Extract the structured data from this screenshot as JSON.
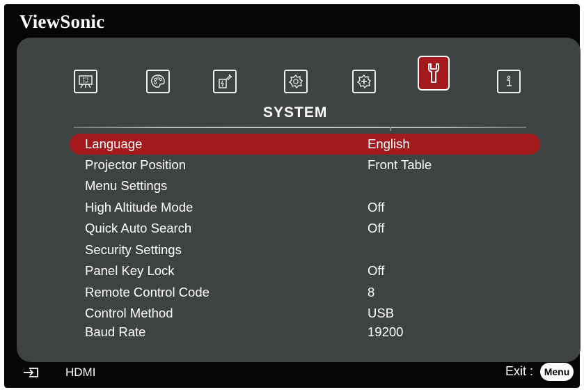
{
  "brand": "ViewSonic",
  "section_title": "SYSTEM",
  "tabs": [
    {
      "name": "display",
      "icon": "display-icon"
    },
    {
      "name": "picture",
      "icon": "palette-icon"
    },
    {
      "name": "power-management",
      "icon": "power-management-icon"
    },
    {
      "name": "basic",
      "icon": "basic-gear-icon"
    },
    {
      "name": "advanced",
      "icon": "advanced-gear-icon"
    },
    {
      "name": "system",
      "icon": "wrench-icon",
      "active": true
    },
    {
      "name": "information",
      "icon": "info-icon"
    }
  ],
  "menu": [
    {
      "label": "Language",
      "value": "English",
      "selected": true
    },
    {
      "label": "Projector Position",
      "value": "Front Table"
    },
    {
      "label": "Menu Settings",
      "value": ""
    },
    {
      "label": "High Altitude Mode",
      "value": "Off"
    },
    {
      "label": "Quick Auto Search",
      "value": "Off"
    },
    {
      "label": "Security Settings",
      "value": ""
    },
    {
      "label": "Panel Key Lock",
      "value": "Off"
    },
    {
      "label": "Remote Control Code",
      "value": "8"
    },
    {
      "label": "Control Method",
      "value": "USB"
    },
    {
      "label": "Baud Rate",
      "value": "19200"
    }
  ],
  "footer": {
    "source": "HDMI",
    "exit_label": "Exit :",
    "menu_button": "Menu"
  },
  "colors": {
    "accent": "#a3191c",
    "panel": "#3f4243",
    "background": "#050505"
  }
}
